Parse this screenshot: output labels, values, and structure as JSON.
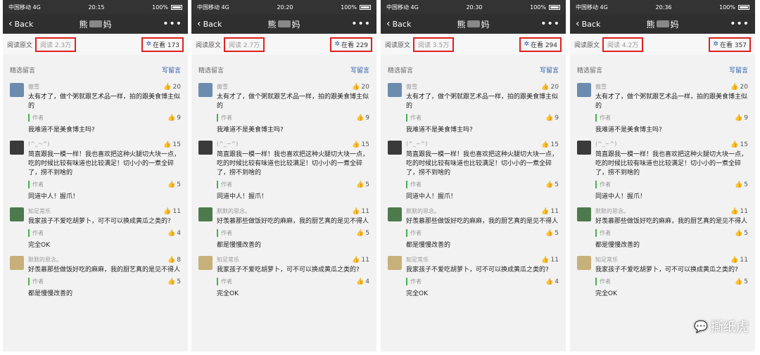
{
  "phones": [
    {
      "status": {
        "carrier": "中国移动",
        "network": "4G",
        "time": "20:15",
        "battery": "100%"
      },
      "nav": {
        "back": "Back",
        "title": "熊",
        "title_end": "妈",
        "more": "•••"
      },
      "read": {
        "label": "阅读原文",
        "count": "阅读 2.3万",
        "zaikan": "在看 173"
      },
      "header": {
        "selected": "精选留言",
        "write": "写留言"
      },
      "comments": [
        {
          "name": "傲雪",
          "likes": "20",
          "text": "太有才了，做个粥就跟艺术品一样，拍的跟美食博主似的",
          "author": "作者",
          "author_likes": "9",
          "reply": "我难道不是美食博主吗?"
        },
        {
          "name": "(^_~^)",
          "likes": "15",
          "text": "简直跟我一模一样！我也喜欢把这种火腿切大块一点，吃的时候比较有味道也比较满足！切小小的一煮全碎了，捞不到啥的",
          "author": "作者",
          "author_likes": "5",
          "reply": "同道中人！握爪！"
        },
        {
          "name": "知足常乐",
          "likes": "11",
          "text": "我家孩子不爱吃胡萝卜，可不可以换成黄瓜之类的?",
          "author": "作者",
          "author_likes": "4",
          "reply": "完全OK"
        },
        {
          "name": "默默的思念。",
          "likes": "8",
          "text": "好羡慕那些做饭好吃的麻麻，我的厨艺真的是见不得人",
          "author": "作者",
          "author_likes": "5",
          "reply": "都是慢慢改善的"
        }
      ]
    },
    {
      "status": {
        "carrier": "中国移动",
        "network": "4G",
        "time": "20:20",
        "battery": "100%"
      },
      "nav": {
        "back": "Back",
        "title": "熊",
        "title_end": "妈",
        "more": "•••"
      },
      "read": {
        "label": "阅读原文",
        "count": "阅读 2.7万",
        "zaikan": "在看 229"
      },
      "header": {
        "selected": "精选留言",
        "write": "写留言"
      },
      "comments": [
        {
          "name": "傲雪",
          "likes": "20",
          "text": "太有才了，做个粥就跟艺术品一样，拍的跟美食博主似的",
          "author": "作者",
          "author_likes": "9",
          "reply": "我难道不是美食博主吗?"
        },
        {
          "name": "(^_~^)",
          "likes": "15",
          "text": "简直跟我一模一样！我也喜欢把这种火腿切大块一点，吃的时候比较有味道也比较满足！切小小的一煮全碎了，捞不到啥的",
          "author": "作者",
          "author_likes": "5",
          "reply": "同道中人！握爪！"
        },
        {
          "name": "默默的思念。",
          "likes": "11",
          "text": "好羡慕那些做饭好吃的麻麻，我的厨艺真的是见不得人",
          "author": "作者",
          "author_likes": "5",
          "reply": "都是慢慢改善的"
        },
        {
          "name": "知足常乐",
          "likes": "11",
          "text": "我家孩子不爱吃胡萝卜，可不可以换成黄瓜之类的?",
          "author": "作者",
          "author_likes": "4",
          "reply": "完全OK"
        }
      ]
    },
    {
      "status": {
        "carrier": "中国移动",
        "network": "4G",
        "time": "20:30",
        "battery": "100%"
      },
      "nav": {
        "back": "Back",
        "title": "熊",
        "title_end": "妈",
        "more": "•••"
      },
      "read": {
        "label": "阅读原文",
        "count": "阅读 3.5万",
        "zaikan": "在看 294"
      },
      "header": {
        "selected": "精选留言",
        "write": "写留言"
      },
      "comments": [
        {
          "name": "傲雪",
          "likes": "20",
          "text": "太有才了，做个粥就跟艺术品一样，拍的跟美食博主似的",
          "author": "作者",
          "author_likes": "9",
          "reply": "我难道不是美食博主吗?"
        },
        {
          "name": "(^_~^)",
          "likes": "15",
          "text": "简直跟我一模一样！我也喜欢把这种火腿切大块一点，吃的时候比较有味道也比较满足！切小小的一煮全碎了，捞不到啥的",
          "author": "作者",
          "author_likes": "5",
          "reply": "同道中人！握爪！"
        },
        {
          "name": "默默的思念。",
          "likes": "11",
          "text": "好羡慕那些做饭好吃的麻麻，我的厨艺真的是见不得人",
          "author": "作者",
          "author_likes": "5",
          "reply": "都是慢慢改善的"
        },
        {
          "name": "知足常乐",
          "likes": "11",
          "text": "我家孩子不爱吃胡萝卜，可不可以换成黄瓜之类的?",
          "author": "作者",
          "author_likes": "4",
          "reply": "完全OK"
        }
      ]
    },
    {
      "status": {
        "carrier": "中国移动",
        "network": "4G",
        "time": "20:36",
        "battery": "100%"
      },
      "nav": {
        "back": "Back",
        "title": "熊",
        "title_end": "妈",
        "more": "•••"
      },
      "read": {
        "label": "阅读原文",
        "count": "阅读 4.2万",
        "zaikan": "在看 357"
      },
      "header": {
        "selected": "精选留言",
        "write": "写留言"
      },
      "comments": [
        {
          "name": "傲雪",
          "likes": "20",
          "text": "太有才了，做个粥就跟艺术品一样，拍的跟美食博主似的",
          "author": "作者",
          "author_likes": "9",
          "reply": "我难道不是美食博主吗?"
        },
        {
          "name": "(^_~^)",
          "likes": "15",
          "text": "简直跟我一模一样！我也喜欢把这种火腿切大块一点，吃的时候比较有味道也比较满足！切小小的一煮全碎了，捞不到啥的",
          "author": "作者",
          "author_likes": "5",
          "reply": "同道中人！握爪！"
        },
        {
          "name": "默默的思念。",
          "likes": "11",
          "text": "好羡慕那些做饭好吃的麻麻，我的厨艺真的是见不得人",
          "author": "作者",
          "author_likes": "5",
          "reply": "都是慢慢改善的"
        },
        {
          "name": "知足常乐",
          "likes": "11",
          "text": "我家孩子不爱吃胡萝卜，可不可以换成黄瓜之类的?",
          "author": "作者",
          "author_likes": "5",
          "reply": "完全OK"
        }
      ]
    }
  ],
  "watermark": {
    "text": "撕纸虎"
  },
  "colors": {
    "highlight_box": "#e02020",
    "link": "#2a5caa",
    "author_bar": "#46b34b"
  }
}
